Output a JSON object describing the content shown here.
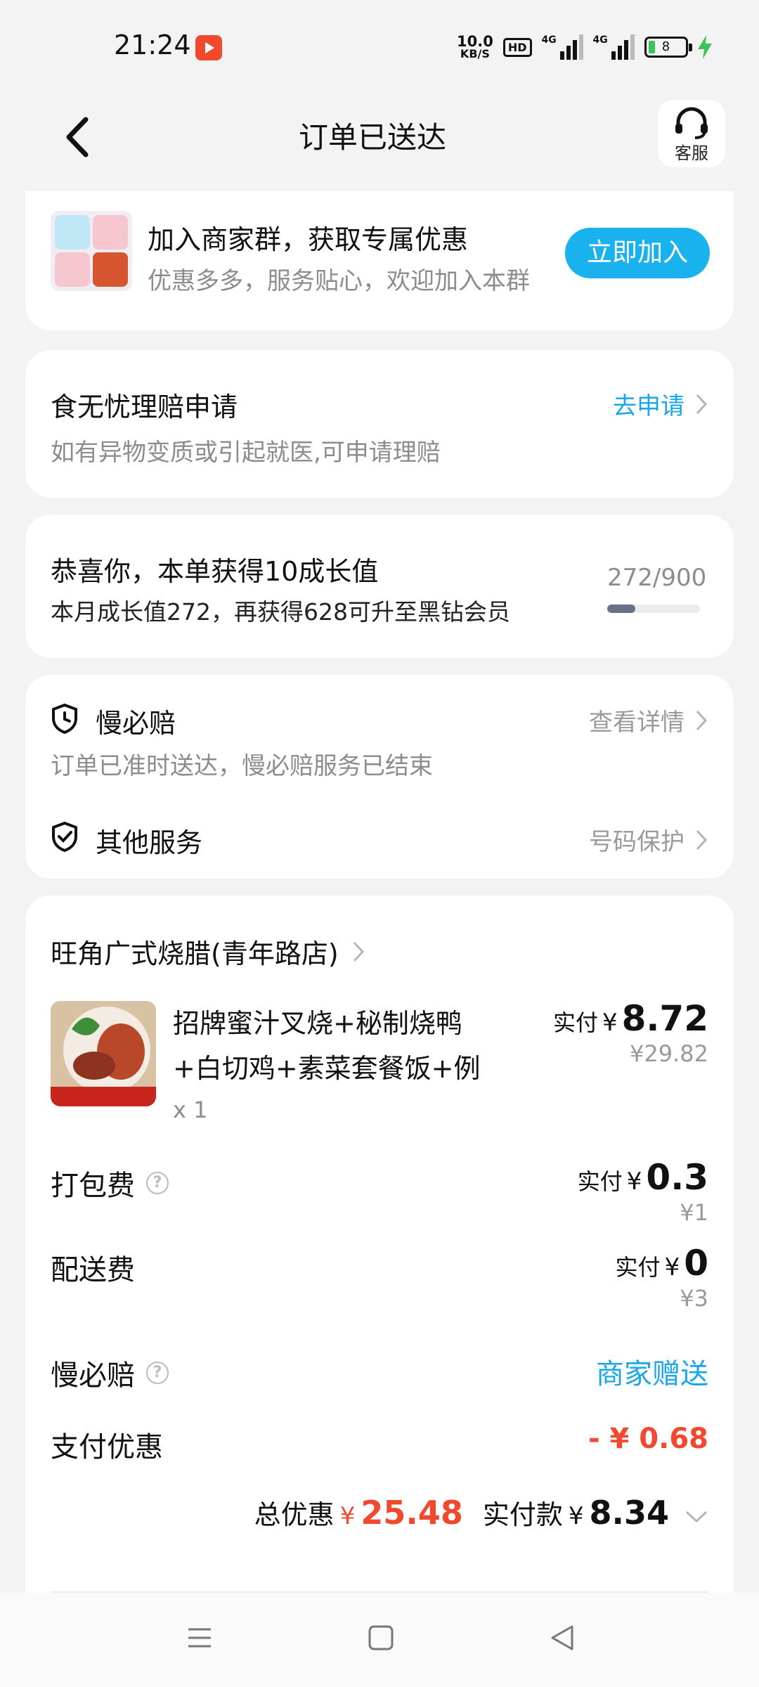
{
  "status_bar": {
    "time": "21:24",
    "net_speed_value": "10.0",
    "net_speed_unit": "KB/S",
    "hd_label": "HD",
    "signal1_label": "4G",
    "signal2_label": "4G",
    "battery_level": "8"
  },
  "header": {
    "title": "订单已送达",
    "service_label": "客服"
  },
  "merchant_group": {
    "title": "加入商家群，获取专属优惠",
    "subtitle": "优惠多多，服务贴心，欢迎加入本群",
    "join_label": "立即加入"
  },
  "food_safety": {
    "title": "食无忧理赔申请",
    "subtitle": "如有异物变质或引起就医,可申请理赔",
    "action": "去申请"
  },
  "growth": {
    "title": "恭喜你，本单获得10成长值",
    "subtitle": "本月成长值272，再获得628可升至黑钻会员",
    "progress_text": "272/900",
    "progress_fraction": 0.302
  },
  "services": {
    "slow_pay_title": "慢必赔",
    "slow_pay_action": "查看详情",
    "slow_pay_note": "订单已准时送达，慢必赔服务已结束",
    "other_title": "其他服务",
    "other_action": "号码保护"
  },
  "order": {
    "shop_name": "旺角广式烧腊(青年路店)",
    "item_name": "招牌蜜汁叉烧+秘制烧鸭+白切鸡+素菜套餐饭+例汤",
    "item_qty": "x 1",
    "item_paid_label": "实付",
    "item_paid_yen": "¥",
    "item_paid": "8.72",
    "item_original": "¥29.82",
    "packing_label": "打包费",
    "packing_paid_label": "实付",
    "packing_paid_yen": "¥",
    "packing_paid": "0.3",
    "packing_original": "¥1",
    "delivery_label": "配送费",
    "delivery_paid_label": "实付",
    "delivery_paid_yen": "¥",
    "delivery_paid": "0",
    "delivery_original": "¥3",
    "slow_pay_label": "慢必赔",
    "slow_pay_value": "商家赠送",
    "pay_discount_label": "支付优惠",
    "pay_discount_value": "- ¥ 0.68",
    "total_discount_label": "总优惠",
    "total_discount_yen": "¥",
    "total_discount": "25.48",
    "actual_label": "实付款",
    "actual_yen": "¥",
    "actual": "8.34"
  },
  "colors": {
    "accent_blue": "#1ab2ee",
    "price_red": "#f0492d",
    "background": "#f3f3f3"
  }
}
